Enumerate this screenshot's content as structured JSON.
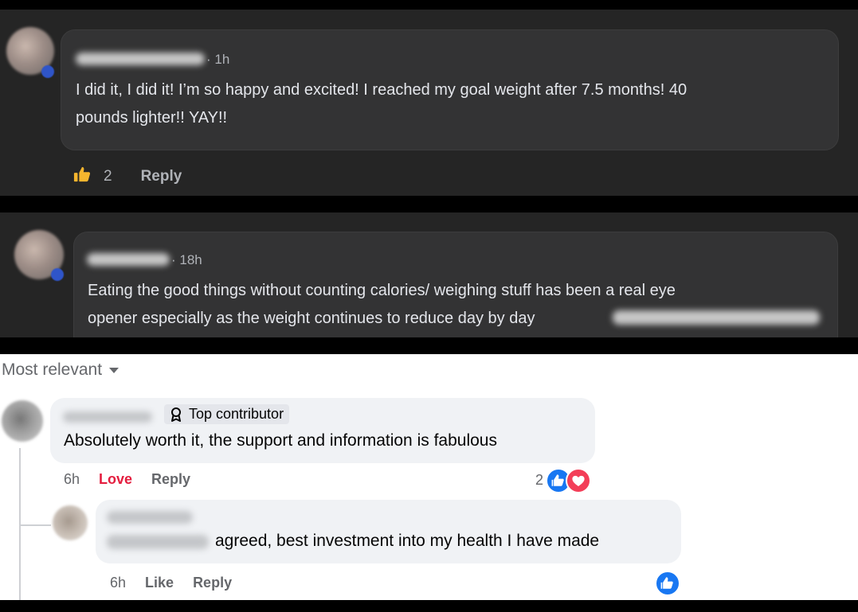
{
  "comments_dark": [
    {
      "time": "1h",
      "text_line1": "I did it, I did it! I’m so happy and excited! I reached my goal weight after 7.5 months! 40",
      "text_line2": "pounds lighter!! YAY!!",
      "like_count": "2",
      "reply_label": "Reply"
    },
    {
      "time": "18h",
      "text_line1": "Eating the good things without counting calories/ weighing stuff has been a real eye",
      "text_line2": "opener especially as the weight continues to reduce day by day"
    }
  ],
  "light_section": {
    "sort_label": "Most relevant",
    "top_comment": {
      "badge": "Top contributor",
      "text": "Absolutely worth it, the support and information is fabulous",
      "time": "6h",
      "reaction_label": "Love",
      "reply_label": "Reply",
      "reaction_count": "2"
    },
    "reply_comment": {
      "text": "agreed, best investment into my health I have made",
      "time": "6h",
      "like_label": "Like",
      "reply_label": "Reply"
    }
  },
  "colors": {
    "dark_panel": "#252525",
    "dark_bubble": "#333334",
    "light_bubble": "#f0f2f5",
    "facebook_blue": "#1877f2",
    "love_red": "#e41e3f"
  },
  "icons": [
    "like-thumb-icon",
    "top-contributor-badge-icon",
    "sort-caret-icon",
    "like-reaction-icon",
    "love-reaction-icon"
  ]
}
